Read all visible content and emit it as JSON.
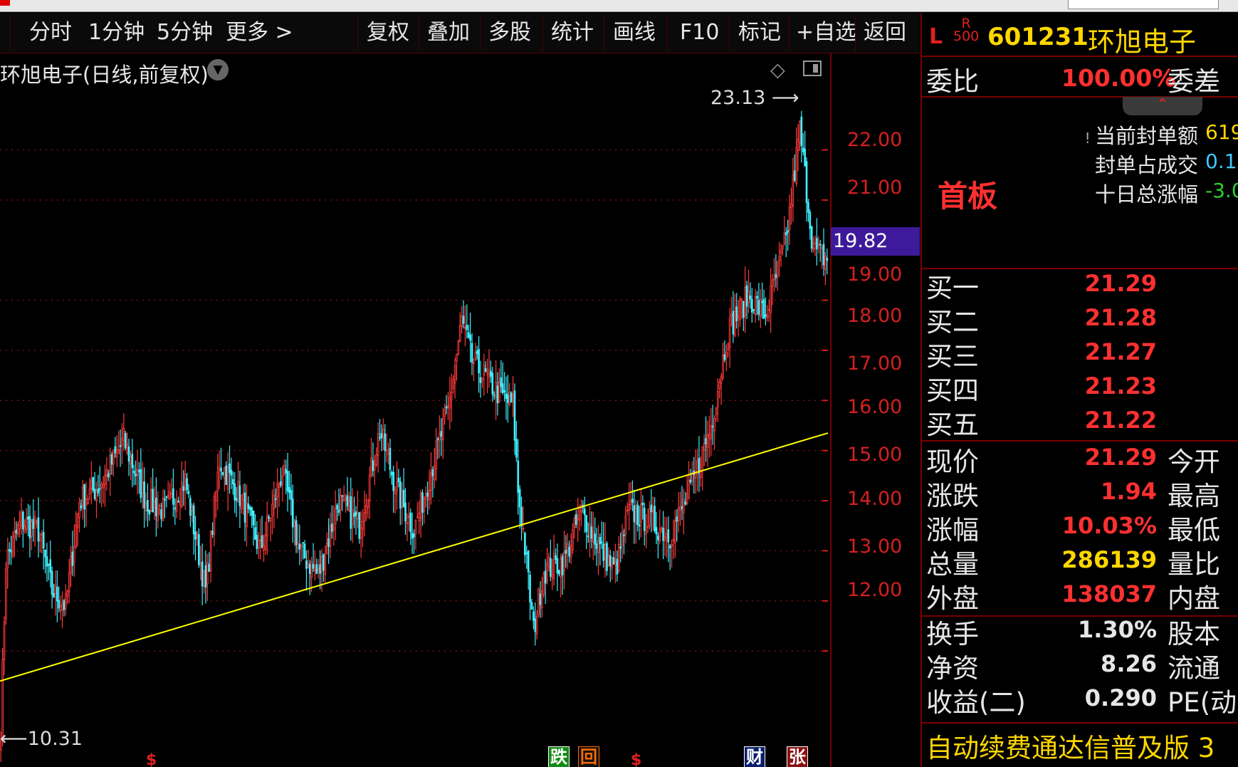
{
  "toolbar": {
    "left": [
      "分时",
      "1分钟",
      "5分钟",
      "更多 >"
    ],
    "right": [
      "复权",
      "叠加",
      "多股",
      "统计",
      "画线",
      "F10",
      "标记",
      "+自选",
      "返回"
    ]
  },
  "chart": {
    "title": "环旭电子(日线,前复权)",
    "y_ticks": [
      "22.00",
      "21.00",
      "19.00",
      "18.00",
      "17.00",
      "16.00",
      "15.00",
      "14.00",
      "13.00",
      "12.00"
    ],
    "current_price_label": "19.82",
    "high_label": "23.13",
    "low_label": "10.31",
    "event_tags": [
      {
        "text": "跌",
        "bg": "#138a13",
        "fg": "#ffffff"
      },
      {
        "text": "回",
        "bg": "#111111",
        "fg": "#ff6a00"
      },
      {
        "text": "财",
        "bg": "#0b1e6e",
        "fg": "#ffffff"
      },
      {
        "text": "张",
        "bg": "#8a1010",
        "fg": "#ffffff"
      }
    ],
    "dividend_mark": "$"
  },
  "chart_data": {
    "type": "candlestick",
    "title": "环旭电子(日线,前复权)",
    "ylim": [
      10.31,
      23.13
    ],
    "trendline": {
      "from_price": 11.4,
      "to_price": 16.35,
      "color": "#ffff00"
    },
    "up_color": "#ff3a3a",
    "down_color": "#3ff0ff",
    "anchors": [
      [
        0,
        10.5
      ],
      [
        3,
        13.8
      ],
      [
        12,
        14.6
      ],
      [
        22,
        14.4
      ],
      [
        30,
        13.2
      ],
      [
        38,
        12.9
      ],
      [
        46,
        15.0
      ],
      [
        58,
        15.3
      ],
      [
        72,
        16.2
      ],
      [
        85,
        15.0
      ],
      [
        96,
        14.8
      ],
      [
        108,
        15.4
      ],
      [
        120,
        13.2
      ],
      [
        128,
        15.8
      ],
      [
        140,
        15.1
      ],
      [
        152,
        14.0
      ],
      [
        165,
        15.6
      ],
      [
        175,
        14.0
      ],
      [
        186,
        13.5
      ],
      [
        198,
        15.0
      ],
      [
        210,
        14.5
      ],
      [
        222,
        16.4
      ],
      [
        232,
        15.2
      ],
      [
        242,
        14.4
      ],
      [
        252,
        15.6
      ],
      [
        262,
        16.8
      ],
      [
        270,
        18.6
      ],
      [
        276,
        17.8
      ],
      [
        290,
        17.2
      ],
      [
        300,
        16.9
      ],
      [
        303,
        15.2
      ],
      [
        306,
        14.4
      ],
      [
        312,
        12.4
      ],
      [
        318,
        13.6
      ],
      [
        330,
        13.8
      ],
      [
        340,
        14.8
      ],
      [
        352,
        14.0
      ],
      [
        360,
        13.6
      ],
      [
        368,
        14.8
      ],
      [
        380,
        14.6
      ],
      [
        392,
        14.3
      ],
      [
        405,
        15.3
      ],
      [
        416,
        16.5
      ],
      [
        426,
        18.4
      ],
      [
        438,
        19.1
      ],
      [
        448,
        18.7
      ],
      [
        460,
        20.2
      ],
      [
        468,
        22.4
      ],
      [
        476,
        20.0
      ],
      [
        484,
        19.82
      ]
    ]
  },
  "right_panel": {
    "limit_tag": "L",
    "r500": "R\n500",
    "code": "601231",
    "name": "环旭电子",
    "weibi_label": "委比",
    "weibi_value": "100.00%",
    "weicha_label": "委差",
    "chevron": "⌃",
    "board_tag": "首板",
    "info": [
      {
        "label": "当前封单额",
        "value": "619",
        "color": "#ffd700"
      },
      {
        "label": "封单占成交",
        "value": "0.1",
        "color": "#3fc8ff"
      },
      {
        "label": "十日总涨幅",
        "value": "-3.0",
        "color": "#2dd12d"
      }
    ],
    "bids": [
      {
        "label": "买一",
        "price": "21.29"
      },
      {
        "label": "买二",
        "price": "21.28"
      },
      {
        "label": "买三",
        "price": "21.27"
      },
      {
        "label": "买四",
        "price": "21.23"
      },
      {
        "label": "买五",
        "price": "21.22"
      }
    ],
    "quote_rows": [
      {
        "label": "现价",
        "value": "21.29",
        "color": "#ff3030",
        "label2": "今开"
      },
      {
        "label": "涨跌",
        "value": "1.94",
        "color": "#ff3030",
        "label2": "最高"
      },
      {
        "label": "涨幅",
        "value": "10.03%",
        "color": "#ff3030",
        "label2": "最低"
      },
      {
        "label": "总量",
        "value": "286139",
        "color": "#ffd700",
        "label2": "量比"
      },
      {
        "label": "外盘",
        "value": "138037",
        "color": "#ff3030",
        "label2": "内盘"
      }
    ],
    "fund_rows": [
      {
        "label": "换手",
        "value": "1.30%",
        "color": "#e6e6e6",
        "label2": "股本"
      },
      {
        "label": "净资",
        "value": "8.26",
        "color": "#e6e6e6",
        "label2": "流通"
      },
      {
        "label": "收益(二)",
        "value": "0.290",
        "color": "#e6e6e6",
        "label2": "PE(动)"
      }
    ],
    "ticker": "自动续费通达信普及版 3"
  }
}
